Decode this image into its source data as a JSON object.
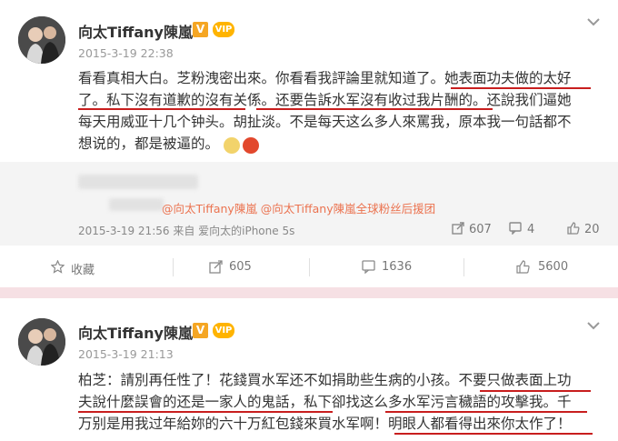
{
  "post1": {
    "username": "向太Tiffany陳嵐",
    "verified_mark": "V",
    "vip_mark": "VIP",
    "timestamp": "2015-3-19 22:38",
    "lines": [
      "看看真相大白。芝粉洩密出來。你看看我評論里就知道了。她表面功夫做的太好",
      "了。私下沒有道歉的沒有关係。还要告訴水军沒有收过我片酬的。还說我们逼她",
      "每天用威亚十几个钟头。胡扯淡。不是每天这么多人來罵我，原本我一句話都不",
      "想说的，都是被逼的。"
    ],
    "repost": {
      "mentions": "@向太Tiffany陳嵐 @向太Tiffany陳嵐全球粉丝后援团",
      "meta": "2015-3-19 21:56 来自 爱向太的iPhone 5s",
      "forward_count": "607",
      "comment_count": "4",
      "like_count": "20"
    },
    "actions": {
      "favorite_label": "收藏",
      "share_count": "605",
      "comment_count": "1636",
      "like_count": "5600"
    }
  },
  "post2": {
    "username": "向太Tiffany陳嵐",
    "verified_mark": "V",
    "vip_mark": "VIP",
    "timestamp": "2015-3-19 21:13",
    "lines": [
      "柏芝：請別再任性了！花錢買水军还不如捐助些生病的小孩。不要只做表面上功",
      "夫說什麼誤會的还是一家人的鬼話，私下卻找这么多水军污言穢語的攻擊我。千",
      "万别是用我过年給妳的六十万紅包錢來買水军啊！明眼人都看得出來你太作了！"
    ]
  },
  "colors": {
    "accent_red": "#c81e1e",
    "mention": "#eb7350",
    "band": "#f6e0e4"
  },
  "icons": {
    "menu": "chevron-down-icon",
    "favorite": "star-icon",
    "share": "share-icon",
    "comment": "comment-icon",
    "like": "thumbs-up-icon"
  }
}
